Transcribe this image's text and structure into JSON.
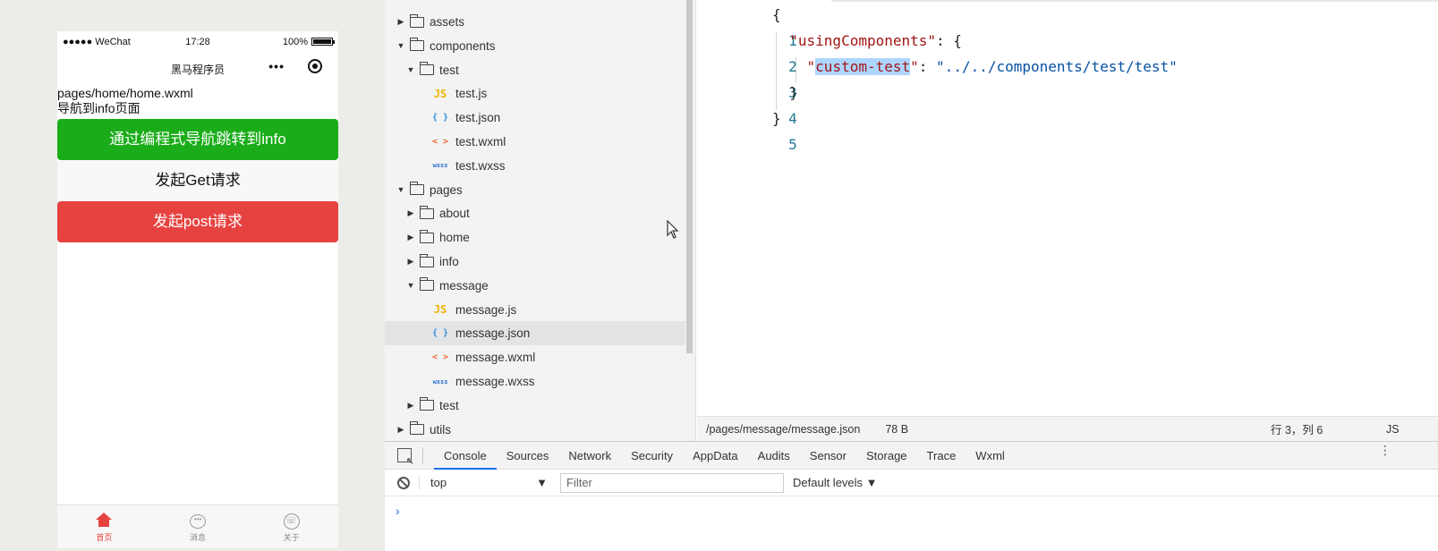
{
  "simulator": {
    "status_bar": {
      "carrier": "●●●●● WeChat",
      "time": "17:28",
      "battery": "100%"
    },
    "nav_title": "黑马程序员",
    "page_path": "pages/home/home.wxml",
    "nav_text": "导航到info页面",
    "buttons": {
      "nav": "通过编程式导航跳转到info",
      "get": "发起Get请求",
      "post": "发起post请求"
    },
    "tabs": [
      {
        "label": "首页",
        "icon": "home-icon",
        "active": true
      },
      {
        "label": "消息",
        "icon": "message-icon",
        "active": false
      },
      {
        "label": "关于",
        "icon": "about-icon",
        "active": false
      }
    ]
  },
  "file_tree": [
    {
      "name": "assets",
      "type": "folder",
      "expanded": false,
      "depth": 0
    },
    {
      "name": "components",
      "type": "folder",
      "expanded": true,
      "depth": 0
    },
    {
      "name": "test",
      "type": "folder",
      "expanded": true,
      "depth": 1
    },
    {
      "name": "test.js",
      "type": "js",
      "depth": 2
    },
    {
      "name": "test.json",
      "type": "json",
      "depth": 2
    },
    {
      "name": "test.wxml",
      "type": "wxml",
      "depth": 2
    },
    {
      "name": "test.wxss",
      "type": "wxss",
      "depth": 2
    },
    {
      "name": "pages",
      "type": "folder",
      "expanded": true,
      "depth": 0
    },
    {
      "name": "about",
      "type": "folder",
      "expanded": false,
      "depth": 1
    },
    {
      "name": "home",
      "type": "folder",
      "expanded": false,
      "depth": 1
    },
    {
      "name": "info",
      "type": "folder",
      "expanded": false,
      "depth": 1
    },
    {
      "name": "message",
      "type": "folder",
      "expanded": true,
      "depth": 1
    },
    {
      "name": "message.js",
      "type": "js",
      "depth": 2
    },
    {
      "name": "message.json",
      "type": "json",
      "depth": 2,
      "selected": true
    },
    {
      "name": "message.wxml",
      "type": "wxml",
      "depth": 2
    },
    {
      "name": "message.wxss",
      "type": "wxss",
      "depth": 2
    },
    {
      "name": "test",
      "type": "folder",
      "expanded": false,
      "depth": 1
    },
    {
      "name": "utils",
      "type": "folder",
      "expanded": false,
      "depth": 0
    }
  ],
  "file_icons": {
    "js": "JS",
    "json": "{ }",
    "wxml": "< >",
    "wxss": "wxss"
  },
  "editor": {
    "lines": [
      {
        "num": "1",
        "text": "{"
      },
      {
        "num": "2",
        "text": "  \"usingComponents\": {"
      },
      {
        "num": "3",
        "text": "    \"custom-test\": \"../../components/test/test\""
      },
      {
        "num": "4",
        "text": "  }"
      },
      {
        "num": "5",
        "text": "}"
      }
    ],
    "line3": {
      "key": "custom-test",
      "value": "\"../../components/test/test\""
    },
    "line2_key": "\"usingComponents\""
  },
  "status": {
    "path": "/pages/message/message.json",
    "size": "78 B",
    "position": "行 3，列 6",
    "language": "JS"
  },
  "devtools": {
    "tabs": [
      "Console",
      "Sources",
      "Network",
      "Security",
      "AppData",
      "Audits",
      "Sensor",
      "Storage",
      "Trace",
      "Wxml"
    ],
    "active_tab": "Console",
    "context": "top",
    "filter_placeholder": "Filter",
    "levels": "Default levels ▼",
    "prompt": "›"
  },
  "colors": {
    "green_button": "#1aad19",
    "red_button": "#e64340",
    "json_key": "#a31515",
    "json_string": "#0451a5",
    "selection": "#add6ff"
  }
}
